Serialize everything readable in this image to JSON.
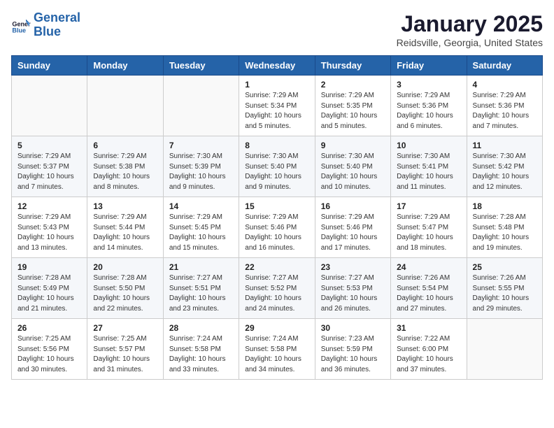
{
  "header": {
    "logo_line1": "General",
    "logo_line2": "Blue",
    "month": "January 2025",
    "location": "Reidsville, Georgia, United States"
  },
  "weekdays": [
    "Sunday",
    "Monday",
    "Tuesday",
    "Wednesday",
    "Thursday",
    "Friday",
    "Saturday"
  ],
  "weeks": [
    [
      {
        "day": "",
        "sunrise": "",
        "sunset": "",
        "daylight": ""
      },
      {
        "day": "",
        "sunrise": "",
        "sunset": "",
        "daylight": ""
      },
      {
        "day": "",
        "sunrise": "",
        "sunset": "",
        "daylight": ""
      },
      {
        "day": "1",
        "sunrise": "Sunrise: 7:29 AM",
        "sunset": "Sunset: 5:34 PM",
        "daylight": "Daylight: 10 hours and 5 minutes."
      },
      {
        "day": "2",
        "sunrise": "Sunrise: 7:29 AM",
        "sunset": "Sunset: 5:35 PM",
        "daylight": "Daylight: 10 hours and 5 minutes."
      },
      {
        "day": "3",
        "sunrise": "Sunrise: 7:29 AM",
        "sunset": "Sunset: 5:36 PM",
        "daylight": "Daylight: 10 hours and 6 minutes."
      },
      {
        "day": "4",
        "sunrise": "Sunrise: 7:29 AM",
        "sunset": "Sunset: 5:36 PM",
        "daylight": "Daylight: 10 hours and 7 minutes."
      }
    ],
    [
      {
        "day": "5",
        "sunrise": "Sunrise: 7:29 AM",
        "sunset": "Sunset: 5:37 PM",
        "daylight": "Daylight: 10 hours and 7 minutes."
      },
      {
        "day": "6",
        "sunrise": "Sunrise: 7:29 AM",
        "sunset": "Sunset: 5:38 PM",
        "daylight": "Daylight: 10 hours and 8 minutes."
      },
      {
        "day": "7",
        "sunrise": "Sunrise: 7:30 AM",
        "sunset": "Sunset: 5:39 PM",
        "daylight": "Daylight: 10 hours and 9 minutes."
      },
      {
        "day": "8",
        "sunrise": "Sunrise: 7:30 AM",
        "sunset": "Sunset: 5:40 PM",
        "daylight": "Daylight: 10 hours and 9 minutes."
      },
      {
        "day": "9",
        "sunrise": "Sunrise: 7:30 AM",
        "sunset": "Sunset: 5:40 PM",
        "daylight": "Daylight: 10 hours and 10 minutes."
      },
      {
        "day": "10",
        "sunrise": "Sunrise: 7:30 AM",
        "sunset": "Sunset: 5:41 PM",
        "daylight": "Daylight: 10 hours and 11 minutes."
      },
      {
        "day": "11",
        "sunrise": "Sunrise: 7:30 AM",
        "sunset": "Sunset: 5:42 PM",
        "daylight": "Daylight: 10 hours and 12 minutes."
      }
    ],
    [
      {
        "day": "12",
        "sunrise": "Sunrise: 7:29 AM",
        "sunset": "Sunset: 5:43 PM",
        "daylight": "Daylight: 10 hours and 13 minutes."
      },
      {
        "day": "13",
        "sunrise": "Sunrise: 7:29 AM",
        "sunset": "Sunset: 5:44 PM",
        "daylight": "Daylight: 10 hours and 14 minutes."
      },
      {
        "day": "14",
        "sunrise": "Sunrise: 7:29 AM",
        "sunset": "Sunset: 5:45 PM",
        "daylight": "Daylight: 10 hours and 15 minutes."
      },
      {
        "day": "15",
        "sunrise": "Sunrise: 7:29 AM",
        "sunset": "Sunset: 5:46 PM",
        "daylight": "Daylight: 10 hours and 16 minutes."
      },
      {
        "day": "16",
        "sunrise": "Sunrise: 7:29 AM",
        "sunset": "Sunset: 5:46 PM",
        "daylight": "Daylight: 10 hours and 17 minutes."
      },
      {
        "day": "17",
        "sunrise": "Sunrise: 7:29 AM",
        "sunset": "Sunset: 5:47 PM",
        "daylight": "Daylight: 10 hours and 18 minutes."
      },
      {
        "day": "18",
        "sunrise": "Sunrise: 7:28 AM",
        "sunset": "Sunset: 5:48 PM",
        "daylight": "Daylight: 10 hours and 19 minutes."
      }
    ],
    [
      {
        "day": "19",
        "sunrise": "Sunrise: 7:28 AM",
        "sunset": "Sunset: 5:49 PM",
        "daylight": "Daylight: 10 hours and 21 minutes."
      },
      {
        "day": "20",
        "sunrise": "Sunrise: 7:28 AM",
        "sunset": "Sunset: 5:50 PM",
        "daylight": "Daylight: 10 hours and 22 minutes."
      },
      {
        "day": "21",
        "sunrise": "Sunrise: 7:27 AM",
        "sunset": "Sunset: 5:51 PM",
        "daylight": "Daylight: 10 hours and 23 minutes."
      },
      {
        "day": "22",
        "sunrise": "Sunrise: 7:27 AM",
        "sunset": "Sunset: 5:52 PM",
        "daylight": "Daylight: 10 hours and 24 minutes."
      },
      {
        "day": "23",
        "sunrise": "Sunrise: 7:27 AM",
        "sunset": "Sunset: 5:53 PM",
        "daylight": "Daylight: 10 hours and 26 minutes."
      },
      {
        "day": "24",
        "sunrise": "Sunrise: 7:26 AM",
        "sunset": "Sunset: 5:54 PM",
        "daylight": "Daylight: 10 hours and 27 minutes."
      },
      {
        "day": "25",
        "sunrise": "Sunrise: 7:26 AM",
        "sunset": "Sunset: 5:55 PM",
        "daylight": "Daylight: 10 hours and 29 minutes."
      }
    ],
    [
      {
        "day": "26",
        "sunrise": "Sunrise: 7:25 AM",
        "sunset": "Sunset: 5:56 PM",
        "daylight": "Daylight: 10 hours and 30 minutes."
      },
      {
        "day": "27",
        "sunrise": "Sunrise: 7:25 AM",
        "sunset": "Sunset: 5:57 PM",
        "daylight": "Daylight: 10 hours and 31 minutes."
      },
      {
        "day": "28",
        "sunrise": "Sunrise: 7:24 AM",
        "sunset": "Sunset: 5:58 PM",
        "daylight": "Daylight: 10 hours and 33 minutes."
      },
      {
        "day": "29",
        "sunrise": "Sunrise: 7:24 AM",
        "sunset": "Sunset: 5:58 PM",
        "daylight": "Daylight: 10 hours and 34 minutes."
      },
      {
        "day": "30",
        "sunrise": "Sunrise: 7:23 AM",
        "sunset": "Sunset: 5:59 PM",
        "daylight": "Daylight: 10 hours and 36 minutes."
      },
      {
        "day": "31",
        "sunrise": "Sunrise: 7:22 AM",
        "sunset": "Sunset: 6:00 PM",
        "daylight": "Daylight: 10 hours and 37 minutes."
      },
      {
        "day": "",
        "sunrise": "",
        "sunset": "",
        "daylight": ""
      }
    ]
  ]
}
